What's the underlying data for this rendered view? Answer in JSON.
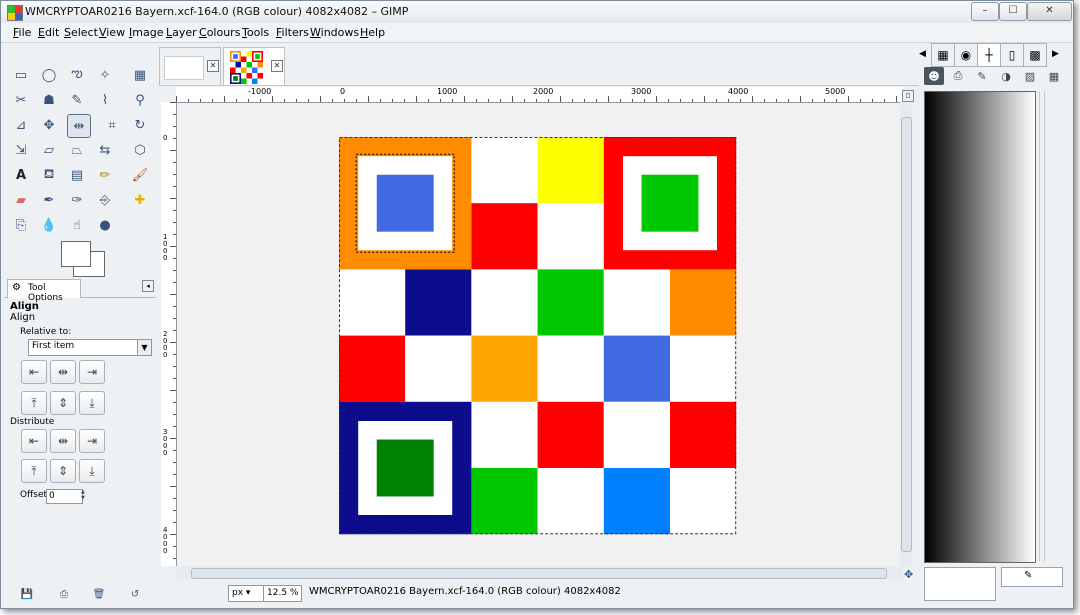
{
  "window": {
    "title": "WMCRYPTOAR0216 Bayern.xcf-164.0 (RGB colour) 4082x4082 – GIMP",
    "controls": {
      "minimize": "–",
      "maximize": "☐",
      "close": "✕"
    }
  },
  "menu": [
    {
      "u": "F",
      "rest": "ile"
    },
    {
      "u": "E",
      "rest": "dit"
    },
    {
      "u": "S",
      "rest": "elect"
    },
    {
      "u": "V",
      "rest": "iew"
    },
    {
      "u": "I",
      "rest": "mage"
    },
    {
      "u": "L",
      "rest": "ayer"
    },
    {
      "u": "C",
      "rest": "olours"
    },
    {
      "u": "T",
      "rest": "ools"
    },
    {
      "u": "F",
      "rest": "ilters"
    },
    {
      "u": "W",
      "rest": "indows"
    },
    {
      "u": "H",
      "rest": "elp"
    }
  ],
  "tool_options": {
    "tab_label": "Tool Options",
    "tool_name": "Align",
    "section_align": "Align",
    "relative_to_label": "Relative to:",
    "relative_to_value": "First item",
    "distribute_label": "Distribute",
    "offset_label": "Offset:",
    "offset_value": "0"
  },
  "rulers": {
    "horizontal": [
      "-1000",
      "0",
      "1000",
      "2000",
      "3000",
      "4000",
      "5000"
    ],
    "vertical": [
      "0",
      "1000",
      "2000",
      "3000",
      "4000"
    ]
  },
  "statusbar": {
    "unit": "px",
    "zoom": "12.5 %",
    "message": "WMCRYPTOAR0216 Bayern.xcf-164.0 (RGB colour) 4082x4082"
  },
  "colors": {
    "orange": "#ff8c00",
    "light_orange": "#ffa500",
    "yellow": "#ffff00",
    "red": "#ff0000",
    "green": "#00c800",
    "dark_green": "#008000",
    "navy": "#0c0c8c",
    "blue": "#4169e1",
    "azure": "#0080ff",
    "white": "#ffffff"
  },
  "image_grid": [
    [
      "orange-square",
      "orange-square",
      "white",
      "yellow",
      "red-square",
      "red-square"
    ],
    [
      "orange-square",
      "orange-square",
      "red",
      "white",
      "red-square",
      "red-square"
    ],
    [
      "white",
      "navy",
      "white",
      "green",
      "white",
      "orange"
    ],
    [
      "red",
      "white",
      "light_orange",
      "white",
      "blue",
      "white"
    ],
    [
      "navy-square",
      "navy-square",
      "white",
      "red",
      "white",
      "red"
    ],
    [
      "navy-square",
      "navy-square",
      "green",
      "white",
      "azure",
      "white"
    ]
  ],
  "corner_squares": [
    {
      "outer": "orange",
      "inner": "blue",
      "row": 0,
      "col": 0
    },
    {
      "outer": "red",
      "inner": "green",
      "row": 0,
      "col": 4
    },
    {
      "outer": "navy",
      "inner": "dark_green",
      "row": 4,
      "col": 0
    }
  ]
}
